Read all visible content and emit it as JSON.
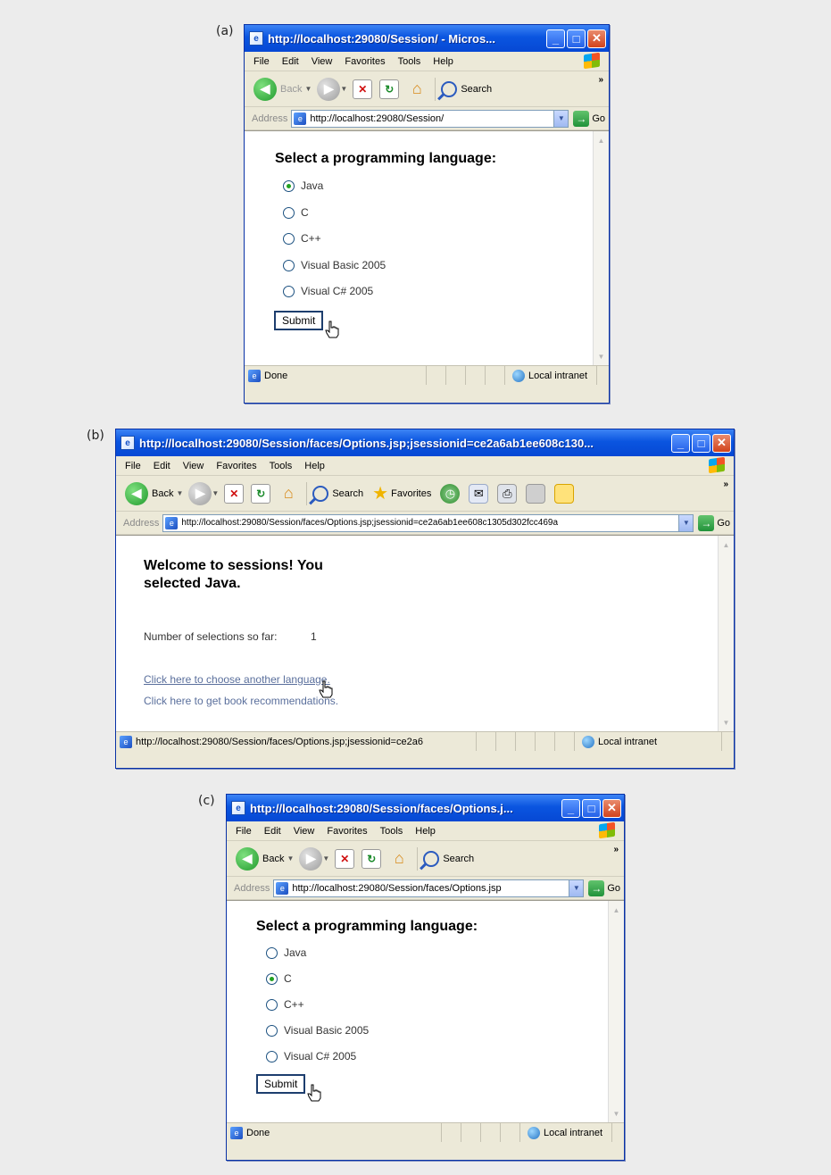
{
  "panels": [
    {
      "label": "(a)",
      "window": {
        "title": "http://localhost:29080/Session/ - Micros...",
        "menu": [
          "File",
          "Edit",
          "View",
          "Favorites",
          "Tools",
          "Help"
        ],
        "toolbar": {
          "back": "Back",
          "search": "Search"
        },
        "address_label": "Address",
        "address": "http://localhost:29080/Session/",
        "go": "Go",
        "status": "Done",
        "zone": "Local intranet"
      },
      "page": {
        "heading": "Select a programming language:",
        "options": [
          "Java",
          "C",
          "C++",
          "Visual Basic 2005",
          "Visual C# 2005"
        ],
        "selected": "Java",
        "submit": "Submit"
      }
    },
    {
      "label": "(b)",
      "window": {
        "title": "http://localhost:29080/Session/faces/Options.jsp;jsessionid=ce2a6ab1ee608c130...",
        "menu": [
          "File",
          "Edit",
          "View",
          "Favorites",
          "Tools",
          "Help"
        ],
        "toolbar": {
          "back": "Back",
          "search": "Search",
          "favorites": "Favorites"
        },
        "address_label": "Address",
        "address": "http://localhost:29080/Session/faces/Options.jsp;jsessionid=ce2a6ab1ee608c1305d302fcc469a",
        "go": "Go",
        "status": "http://localhost:29080/Session/faces/Options.jsp;jsessionid=ce2a6",
        "zone": "Local intranet"
      },
      "page": {
        "welcome_line1": "Welcome to sessions! You",
        "welcome_line2": "selected Java.",
        "count_label": "Number of selections so far:",
        "count_value": "1",
        "link1": "Click here to choose another language.",
        "link2": "Click here to get book recommendations."
      }
    },
    {
      "label": "(c)",
      "window": {
        "title": "http://localhost:29080/Session/faces/Options.j...",
        "menu": [
          "File",
          "Edit",
          "View",
          "Favorites",
          "Tools",
          "Help"
        ],
        "toolbar": {
          "back": "Back",
          "search": "Search"
        },
        "address_label": "Address",
        "address": "http://localhost:29080/Session/faces/Options.jsp",
        "go": "Go",
        "status": "Done",
        "zone": "Local intranet"
      },
      "page": {
        "heading": "Select a programming language:",
        "options": [
          "Java",
          "C",
          "C++",
          "Visual Basic 2005",
          "Visual C# 2005"
        ],
        "selected": "C",
        "submit": "Submit"
      }
    }
  ]
}
